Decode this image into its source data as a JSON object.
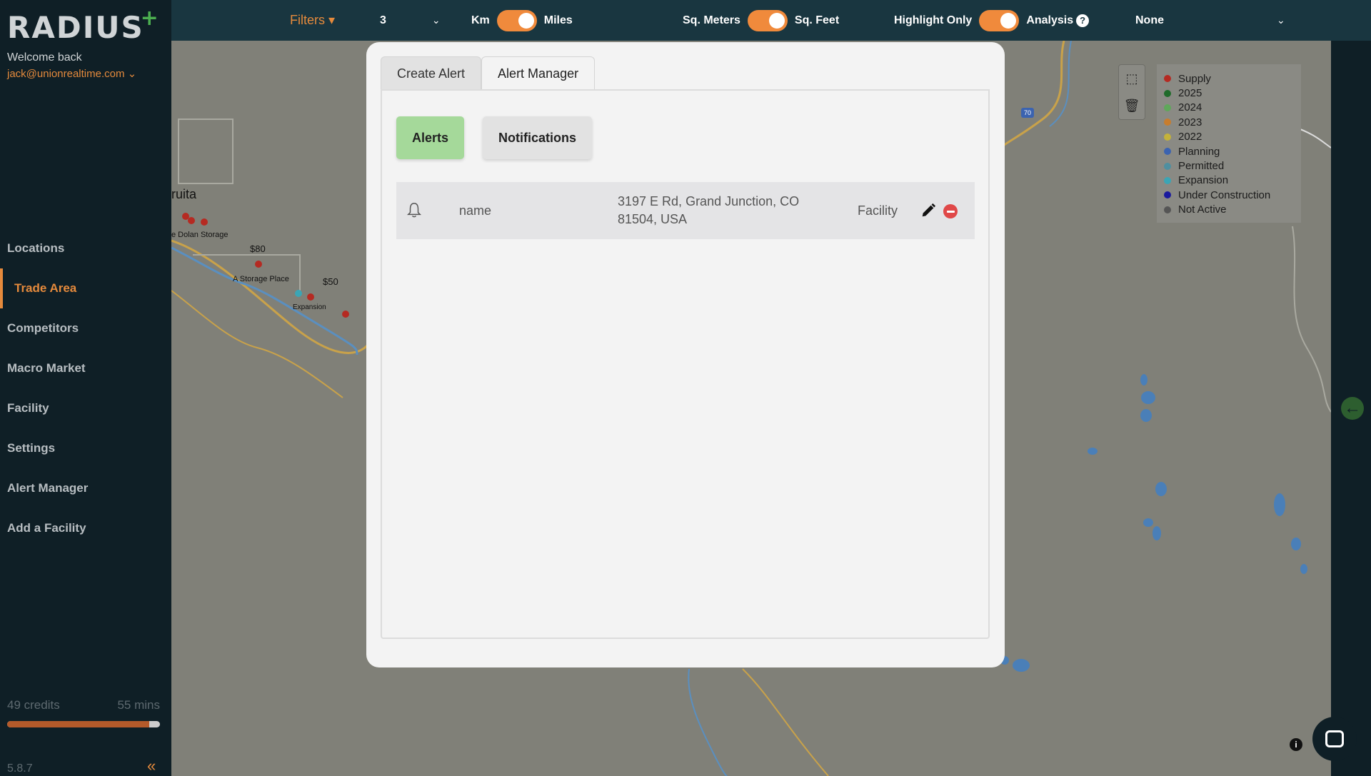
{
  "brand": {
    "name": "RADIUS",
    "plus": "+"
  },
  "user": {
    "welcome": "Welcome back",
    "email": "jack@unionrealtime.com ⌄"
  },
  "nav": [
    {
      "label": "Locations"
    },
    {
      "label": "Trade Area",
      "active": true
    },
    {
      "label": "Competitors"
    },
    {
      "label": "Macro Market"
    },
    {
      "label": "Facility"
    },
    {
      "label": "Settings"
    },
    {
      "label": "Alert Manager"
    },
    {
      "label": "Add a Facility"
    }
  ],
  "footer": {
    "credits": "49 credits",
    "time": "55 mins",
    "credit_level": 0.93,
    "version": "5.8.7",
    "collapse": "«"
  },
  "topbar": {
    "filters": "Filters ▾",
    "count": "3",
    "km": "Km",
    "miles": "Miles",
    "sq_meters": "Sq. Meters",
    "sq_feet": "Sq. Feet",
    "highlight": "Highlight Only",
    "analysis": "Analysis",
    "analysis_help": "?",
    "mode": "None"
  },
  "map_labels": {
    "fruita": "ruita",
    "dolan": "e Dolan Storage",
    "price80": "$80",
    "storage_place": "A Storage Place",
    "price50": "$50",
    "expansion": "Expansion",
    "highway": "70"
  },
  "legend": [
    {
      "label": "Supply",
      "color": "#b52a22"
    },
    {
      "label": "2025",
      "color": "#1f6b2a"
    },
    {
      "label": "2024",
      "color": "#5fa85a"
    },
    {
      "label": "2023",
      "color": "#c77d2e"
    },
    {
      "label": "2022",
      "color": "#c4b23a"
    },
    {
      "label": "Planning",
      "color": "#3b63b0"
    },
    {
      "label": "Permitted",
      "color": "#4f8fa0"
    },
    {
      "label": "Expansion",
      "color": "#3ba5b5"
    },
    {
      "label": "Under Construction",
      "color": "#1a1a9e"
    },
    {
      "label": "Not Active",
      "color": "#555555"
    }
  ],
  "modal": {
    "tabs": [
      {
        "label": "Create Alert"
      },
      {
        "label": "Alert Manager",
        "active": true
      }
    ],
    "buttons": {
      "alerts": "Alerts",
      "notifications": "Notifications"
    },
    "alerts": [
      {
        "name": "name",
        "address": "3197 E Rd, Grand Junction, CO 81504, USA",
        "type": "Facility"
      }
    ]
  },
  "colors": {
    "accent": "#e58a3c",
    "sidebar": "#0f1f26",
    "topbar": "#193640",
    "alerts_active": "#a5d99a",
    "remove": "#e04848"
  }
}
